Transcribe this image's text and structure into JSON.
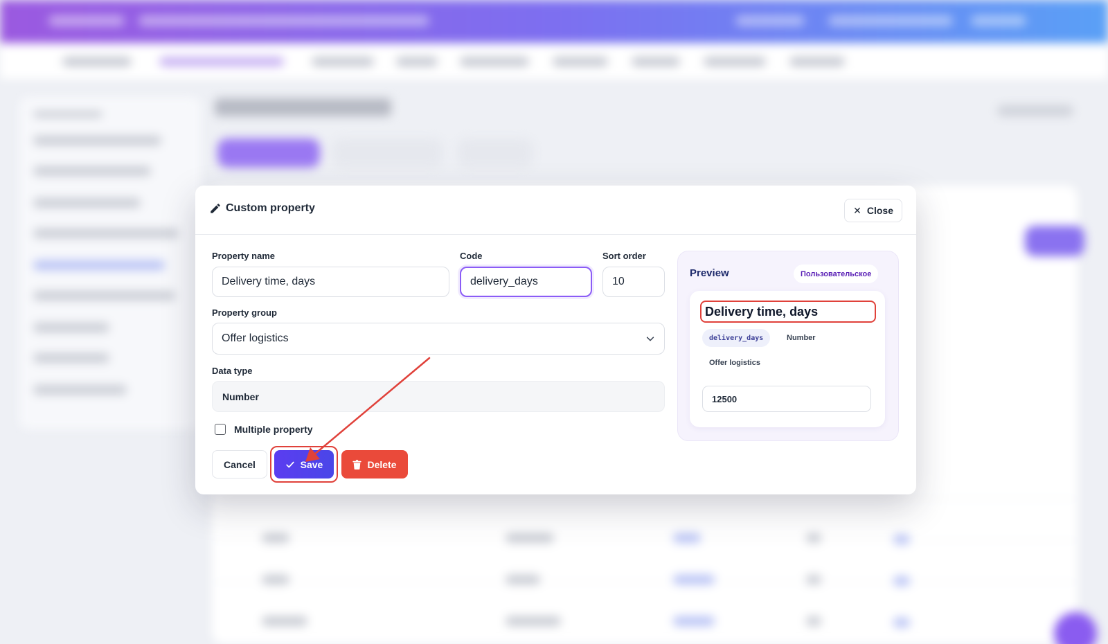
{
  "modal": {
    "title": "Custom property",
    "close_label": "Close"
  },
  "form": {
    "property_name_label": "Property name",
    "property_name_value": "Delivery time, days",
    "code_label": "Code",
    "code_value": "delivery_days",
    "sort_order_label": "Sort order",
    "sort_order_value": "10",
    "group_label": "Property group",
    "group_value": "Offer logistics",
    "data_type_label": "Data type",
    "data_type_value": "Number",
    "multiple_label": "Multiple property",
    "multiple_checked": false
  },
  "actions": {
    "cancel_label": "Cancel",
    "save_label": "Save",
    "delete_label": "Delete"
  },
  "preview": {
    "title": "Preview",
    "badge": "Пользовательское",
    "name": "Delivery time, days",
    "code_chip": "delivery_days",
    "type_chip": "Number",
    "group_chip": "Offer logistics",
    "sample_value": "12500"
  },
  "colors": {
    "accent": "#5b3df0",
    "danger": "#ea4a3a",
    "annotation": "#e0413a",
    "focus": "#8b5cf6"
  },
  "icons": {
    "title": "pencil-icon",
    "close": "close-icon",
    "select": "chevron-down-icon",
    "save": "check-icon",
    "delete": "trash-icon"
  }
}
